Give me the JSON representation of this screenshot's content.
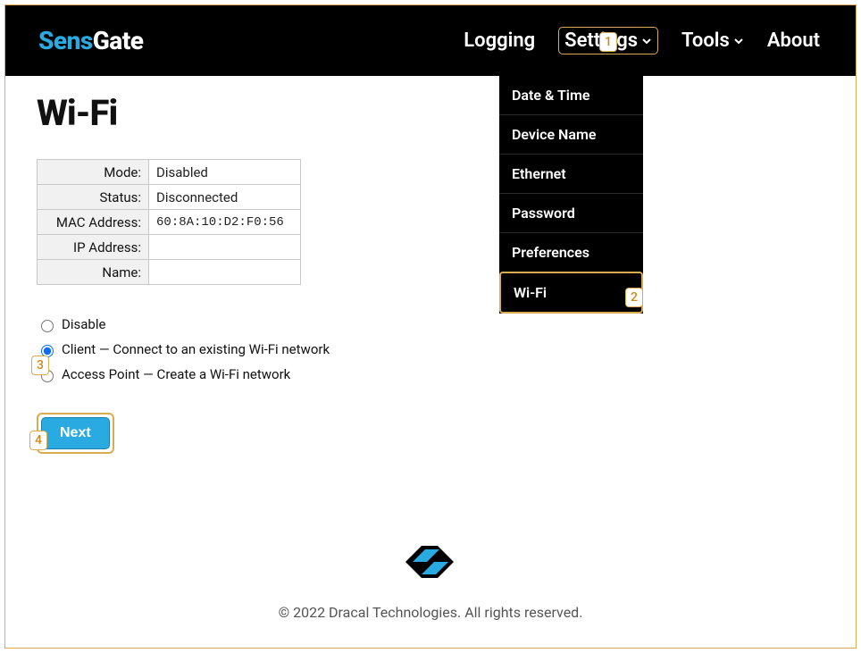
{
  "brand": {
    "accent": "Sens",
    "rest": "Gate"
  },
  "nav": {
    "logging": "Logging",
    "settings": "Settings",
    "tools": "Tools",
    "about": "About"
  },
  "dropdown": {
    "date_time": "Date & Time",
    "device_name": "Device Name",
    "ethernet": "Ethernet",
    "password": "Password",
    "preferences": "Preferences",
    "wifi": "Wi-Fi"
  },
  "page_title": "Wi-Fi",
  "status": {
    "mode_label": "Mode:",
    "mode_value": "Disabled",
    "status_label": "Status:",
    "status_value": "Disconnected",
    "mac_label": "MAC Address:",
    "mac_value": "60:8A:10:D2:F0:56",
    "ip_label": "IP Address:",
    "ip_value": "",
    "name_label": "Name:",
    "name_value": ""
  },
  "options": {
    "disable": "Disable",
    "client": "Client — Connect to an existing Wi-Fi network",
    "ap": "Access Point — Create a Wi-Fi network"
  },
  "next_button": "Next",
  "footer": "© 2022 Dracal Technologies. All rights reserved.",
  "callouts": {
    "c1": "1",
    "c2": "2",
    "c3": "3",
    "c4": "4"
  }
}
